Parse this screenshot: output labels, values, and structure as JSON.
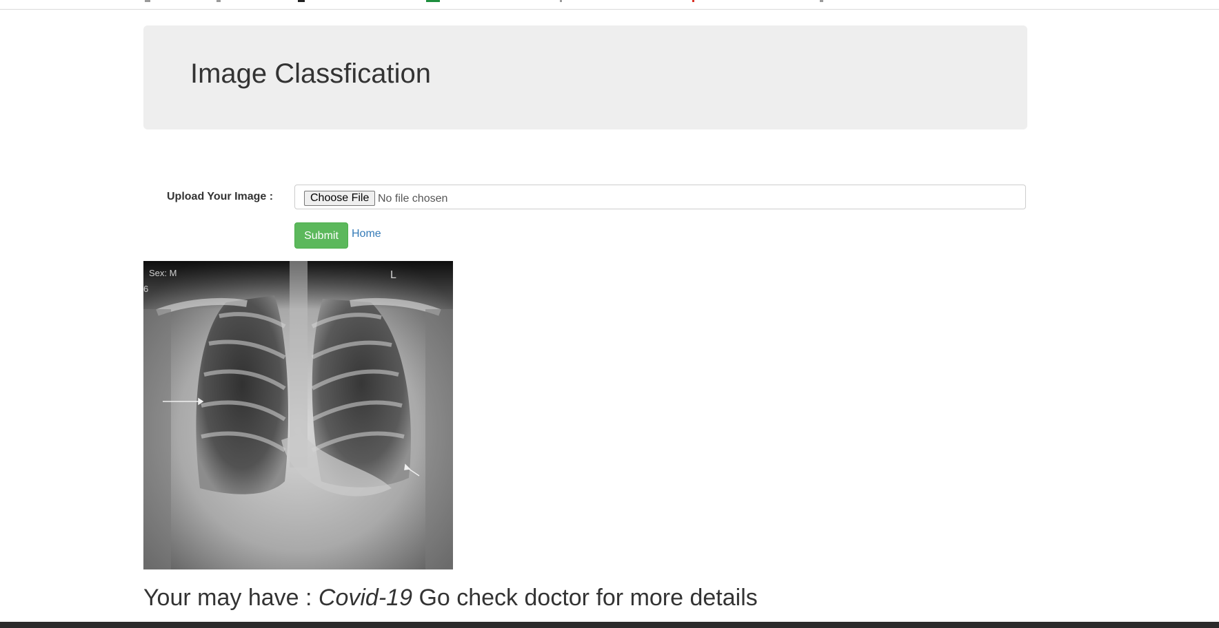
{
  "header": {
    "title": "Image Classfication"
  },
  "form": {
    "upload_label": "Upload Your Image :",
    "choose_file_label": "Choose File",
    "file_status": "No file chosen",
    "submit_label": "Submit",
    "home_link": "Home"
  },
  "image": {
    "overlay_sex": "Sex: M",
    "overlay_side": "L",
    "overlay_edge": "6"
  },
  "result": {
    "prefix": "Your may have :",
    "diagnosis": "Covid-19",
    "suffix": "Go check doctor for more details"
  },
  "colors": {
    "jumbotron_bg": "#eeeeee",
    "submit_bg": "#5cb85c",
    "link": "#337ab7",
    "text": "#333333"
  }
}
